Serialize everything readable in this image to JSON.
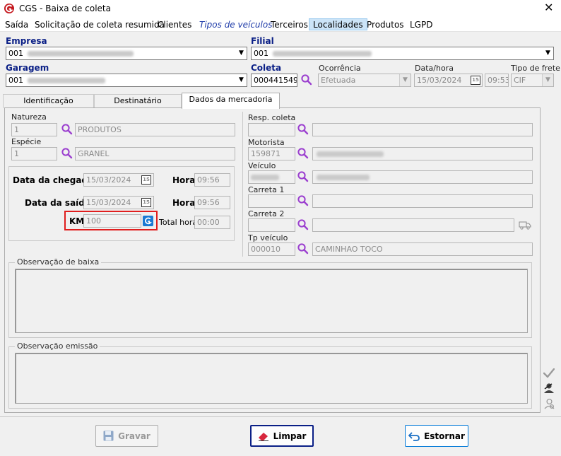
{
  "window": {
    "title": "CGS - Baixa de coleta",
    "close_glyph": "✕"
  },
  "menu": [
    {
      "label": "Saída"
    },
    {
      "label": "Solicitação de coleta resumida"
    },
    {
      "label": "Clientes"
    },
    {
      "label": "Tipos de veículos"
    },
    {
      "label": "Terceiros"
    },
    {
      "label": "Localidades"
    },
    {
      "label": "Produtos"
    },
    {
      "label": "LGPD"
    }
  ],
  "header": {
    "empresa_label": "Empresa",
    "empresa_value": "001",
    "filial_label": "Filial",
    "filial_value": "001",
    "garagem_label": "Garagem",
    "garagem_value": "001",
    "coleta_label": "Coleta",
    "coleta_value": "000441549",
    "ocorrencia_label": "Ocorrência",
    "ocorrencia_value": "Efetuada",
    "datahora_label": "Data/hora",
    "data_value": "15/03/2024",
    "hora_value": "09:53",
    "tipo_frete_label": "Tipo de frete",
    "tipo_frete_value": "CIF"
  },
  "tabs": [
    {
      "label": "Identificação"
    },
    {
      "label": "Destinatário"
    },
    {
      "label": "Dados da mercadoria"
    }
  ],
  "mercadoria": {
    "natureza_label": "Natureza",
    "natureza_code": "1",
    "natureza_desc": "PRODUTOS",
    "especie_label": "Espécie",
    "especie_code": "1",
    "especie_desc": "GRANEL",
    "data_chegada_label": "Data da chegada",
    "data_chegada": "15/03/2024",
    "hora_label": "Hora",
    "hora_chegada": "09:56",
    "data_saida_label": "Data da saída",
    "data_saida": "15/03/2024",
    "hora_saida": "09:56",
    "km_label": "KM",
    "km_value": "100",
    "total_hora_label": "Total hora",
    "total_hora": "00:00",
    "calendar_glyph": "15",
    "resp_coleta_label": "Resp. coleta",
    "motorista_label": "Motorista",
    "motorista_code": "159871",
    "veiculo_label": "Veículo",
    "carreta1_label": "Carreta 1",
    "carreta2_label": "Carreta 2",
    "tp_veiculo_label": "Tp veículo",
    "tp_veiculo_code": "000010",
    "tp_veiculo_desc": "CAMINHAO TOCO",
    "obs_baixa_label": "Observação de baixa",
    "obs_emissao_label": "Observação emissão"
  },
  "buttons": {
    "gravar": "Gravar",
    "limpar": "Limpar",
    "estornar": "Estornar"
  },
  "colors": {
    "accent": "#0a1f86",
    "highlight": "#e01e1e",
    "lookup_icon": "#9b3fcf"
  }
}
